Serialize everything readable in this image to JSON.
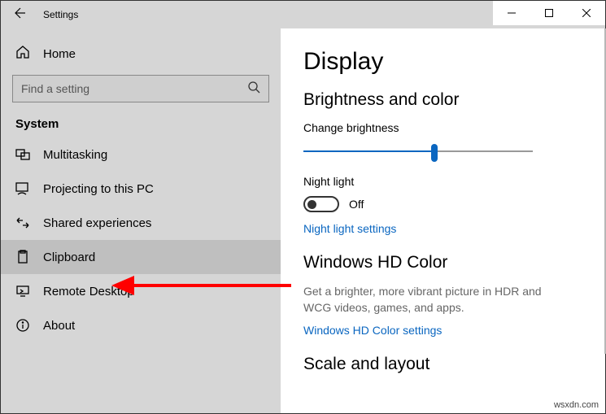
{
  "window": {
    "title": "Settings"
  },
  "sidebar": {
    "home_label": "Home",
    "search_placeholder": "Find a setting",
    "section": "System",
    "items": [
      {
        "label": "Multitasking"
      },
      {
        "label": "Projecting to this PC"
      },
      {
        "label": "Shared experiences"
      },
      {
        "label": "Clipboard"
      },
      {
        "label": "Remote Desktop"
      },
      {
        "label": "About"
      }
    ]
  },
  "content": {
    "title": "Display",
    "brightness_section": "Brightness and color",
    "brightness_label": "Change brightness",
    "brightness_value_pct": 57,
    "night_light_label": "Night light",
    "night_light_state": "Off",
    "night_light_link": "Night light settings",
    "hd_section": "Windows HD Color",
    "hd_desc": "Get a brighter, more vibrant picture in HDR and WCG videos, games, and apps.",
    "hd_link": "Windows HD Color settings",
    "scale_section": "Scale and layout"
  },
  "watermark": "wsxdn.com"
}
